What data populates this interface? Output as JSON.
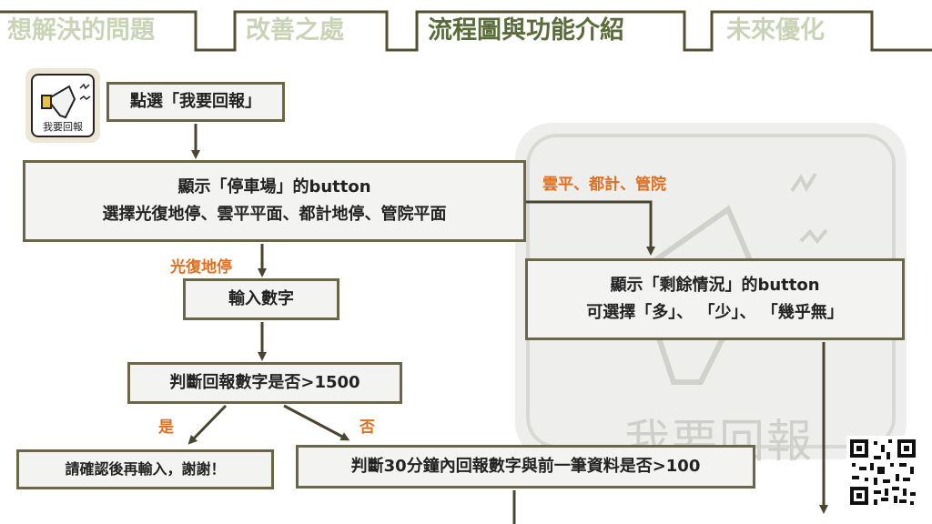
{
  "tabs": [
    {
      "label": "想解決的問題",
      "active": false
    },
    {
      "label": "改善之處",
      "active": false
    },
    {
      "label": "流程圖與功能介紹",
      "active": true
    },
    {
      "label": "未來優化",
      "active": false
    }
  ],
  "app_icon": {
    "label": "我要回報",
    "icon": "megaphone-icon"
  },
  "background_watermark": {
    "text": "我要回報"
  },
  "nodes": {
    "start": "點選「我要回報」",
    "show_parking": {
      "line1": "顯示「停車場」的button",
      "line2": "選擇光復地停、雲平平面、都計地停、管院平面"
    },
    "input_number": "輸入數字",
    "check_1500": "判斷回報數字是否>1500",
    "reenter": "請確認後再輸入，謝謝！",
    "check_100": "判斷30分鐘內回報數字與前一筆資料是否>100",
    "show_remaining": {
      "line1": "顯示「剩餘情況」的button",
      "line2": "可選擇「多」、 「少」、 「幾乎無」"
    }
  },
  "edge_labels": {
    "guangfu": "光復地停",
    "others": "雲平、都計、管院",
    "yes": "是",
    "no": "否"
  },
  "colors": {
    "accent_orange": "#e07020",
    "border": "#6b6645",
    "tab_active": "#5a6b3a",
    "tab_inactive": "#c9d3b6"
  }
}
